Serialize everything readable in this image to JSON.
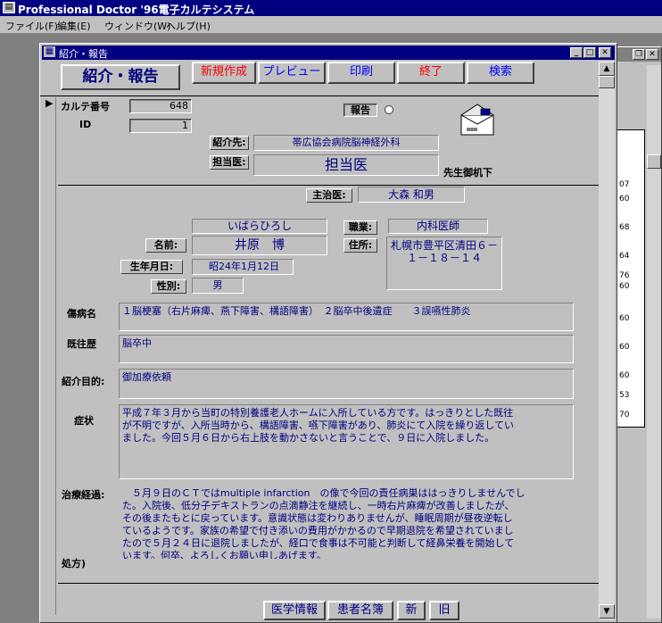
{
  "app": {
    "title": "Professional Doctor '96電子カルテシステム",
    "menu": [
      "ファイル(F)",
      "編集(E)",
      "ウィンドウ(W)",
      "ヘルプ(H)"
    ]
  },
  "form": {
    "title": "紹介・報告",
    "header_label": "紹介・報告",
    "toolbar": {
      "new": "新規作成",
      "preview": "プレビュー",
      "print": "印刷",
      "exit": "終了",
      "search": "検索"
    },
    "colors": {
      "red_text": "#ff0000",
      "blue_text": "#0000ff",
      "navy_text": "#000080"
    },
    "karte_label": "カルテ番号",
    "karte_value": "648",
    "id_label": "ID",
    "id_value": "1",
    "report_label": "報告",
    "referral_to_label": "紹介先:",
    "referral_to_value": "帯広協会病院脳神経外科",
    "doctor_label": "担当医:",
    "doctor_value": "担当医",
    "doctor_suffix": "先生御机下",
    "attending_label": "主治医:",
    "attending_value": "大森 和男",
    "name_kana": "いばらひろし",
    "name_label": "名前:",
    "name_value": "井原　博",
    "job_label": "職業:",
    "job_value": "内科医師",
    "address_label": "住所:",
    "address_line1": "札幌市豊平区清田６－",
    "address_line2": "１－１８－１４",
    "dob_label": "生年月日:",
    "dob_value": "昭24年1月12日",
    "sex_label": "性別:",
    "sex_value": "男",
    "disease_label": "傷病名",
    "disease_value": "１脳梗塞（右片麻痺、燕下障害、構語障害）　２脳卒中後遺症　　３誤嚥性肺炎",
    "history_label": "既往歴",
    "history_value": "脳卒中",
    "purpose_label": "紹介目的:",
    "purpose_value": "御加療依頼",
    "symptom_label": "症状",
    "symptom_value": "平成７年３月から当町の特別養護老人ホームに入所している方です。はっきりとした既往\nが不明ですが、入所当時から、構語障害、嚥下障害があり、肺炎にて入院を繰り返してい\nました。今回５月６日から右上肢を動かさないと言うことで、９日に入院しました。",
    "course_label": "治療経過:",
    "course_value": "　５月９日のＣＴではmultiple infarction　の像で今回の責任病巣ははっきりしませんでし\nた。入院後、低分子デキストランの点滴静注を継続し、一時右片麻痺が改善しましたが、\nその後またもとに戻っています。意識状態は変わりありませんが、睡眠周期が昼夜逆転し\nているようです。家族の希望で付き添いの費用がかかるので早期退院を希望されていまし\nたので５月２４日に退院しましたが、経口で食事は不可能と判断して経鼻栄養を開始して\nいます。何卒、よろしくお願い申しあげます。",
    "prescription_label": "処方)",
    "bottom_tabs": {
      "medical": "医学情報",
      "patient_list": "患者名簿",
      "new": "新",
      "old": "旧"
    }
  },
  "background_window": {
    "numbers": [
      "07",
      "60",
      "68",
      "64",
      "76",
      "60",
      "60",
      "60",
      "60",
      "53",
      "70"
    ]
  }
}
